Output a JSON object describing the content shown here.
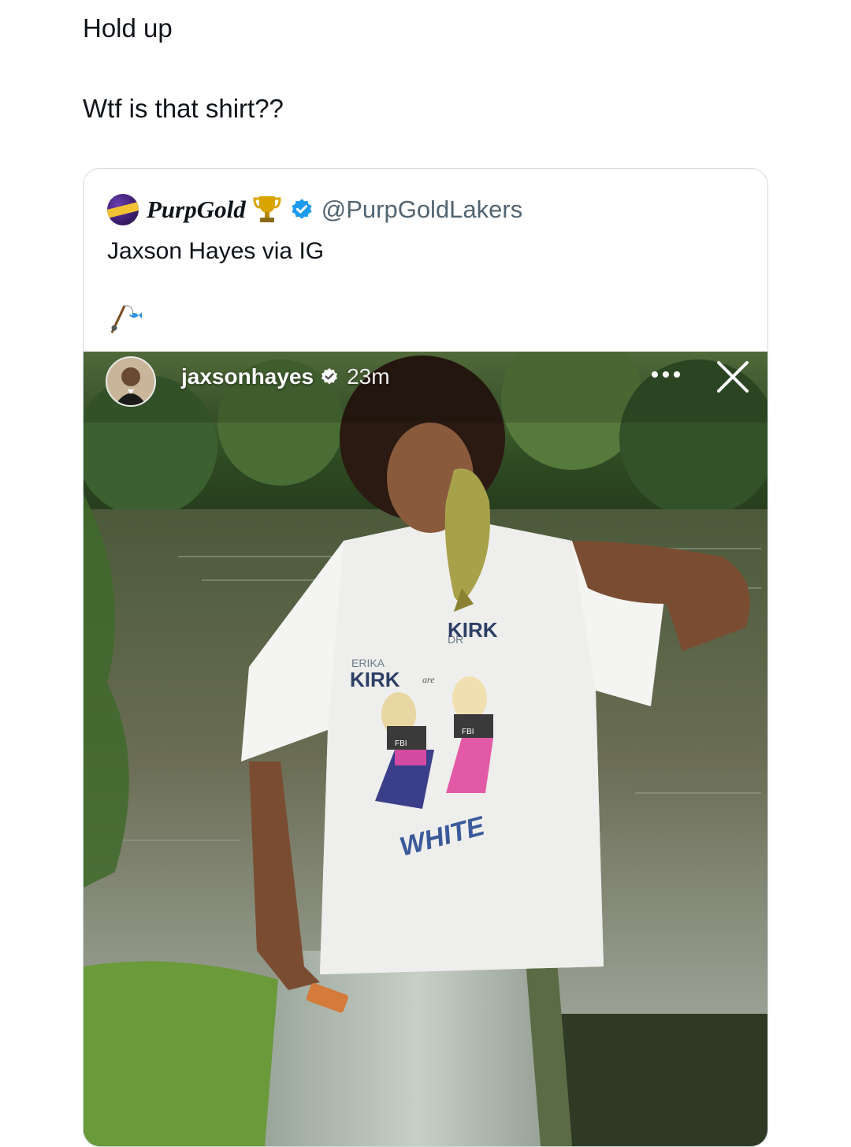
{
  "post": {
    "line1": "Hold up",
    "line2": "Wtf is that shirt??"
  },
  "quote": {
    "name": "PurpGold",
    "handle": "@PurpGoldLakers",
    "text": "Jaxson Hayes via IG",
    "avatar_icon": "purpgold-logo-avatar",
    "badge_icon": "trophy-icon",
    "verified_icon": "verified-badge-icon",
    "emoji_icon": "fishing-pole-fish-icon"
  },
  "story": {
    "username": "jaxsonhayes",
    "time": "23m",
    "more_icon": "more-dots-icon",
    "close_icon": "close-icon",
    "shirt_text": [
      "ERIKA",
      "KIRK",
      "are",
      "DR",
      "KIRK",
      "FBI",
      "FBI"
    ]
  },
  "colors": {
    "text": "#0f1419",
    "secondary": "#536471",
    "verified": "#1d9bf0",
    "border": "#cfd9de",
    "brand_purple": "#3b1e6e",
    "brand_gold": "#f1c232"
  }
}
